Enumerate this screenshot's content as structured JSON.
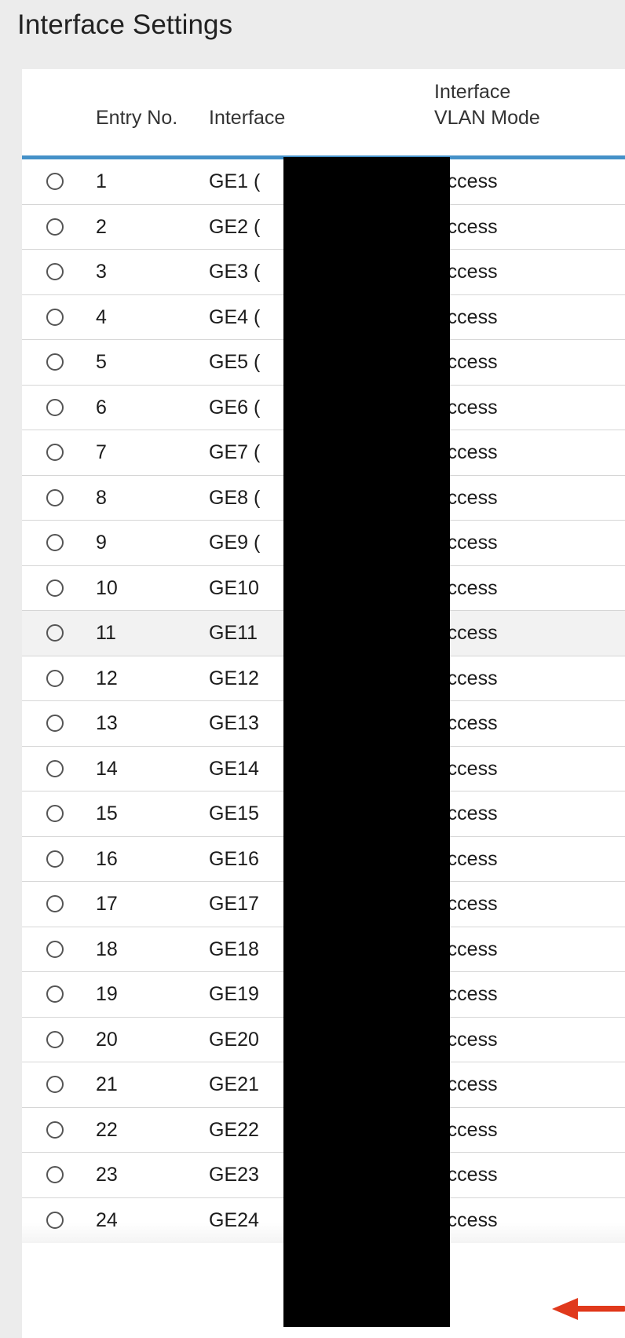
{
  "page": {
    "title": "Interface Settings",
    "background_color": "#ececec"
  },
  "table": {
    "accent_color": "#4591c8",
    "columns": [
      {
        "key": "select",
        "label": ""
      },
      {
        "key": "entry_no",
        "label": "Entry No."
      },
      {
        "key": "interface",
        "label": "Interface"
      },
      {
        "key": "vlan_mode",
        "label": "Interface\nVLAN Mode"
      }
    ],
    "rows": [
      {
        "entry_no": "1",
        "interface": "GE1 (",
        "vlan_mode": "Access",
        "highlighted": false
      },
      {
        "entry_no": "2",
        "interface": "GE2 (",
        "vlan_mode": "Access",
        "highlighted": false
      },
      {
        "entry_no": "3",
        "interface": "GE3 (",
        "vlan_mode": "Access",
        "highlighted": false
      },
      {
        "entry_no": "4",
        "interface": "GE4 (",
        "vlan_mode": "Access",
        "highlighted": false
      },
      {
        "entry_no": "5",
        "interface": "GE5 (",
        "vlan_mode": "Access",
        "highlighted": false
      },
      {
        "entry_no": "6",
        "interface": "GE6 (",
        "vlan_mode": "Access",
        "highlighted": false
      },
      {
        "entry_no": "7",
        "interface": "GE7 (",
        "vlan_mode": "Access",
        "highlighted": false
      },
      {
        "entry_no": "8",
        "interface": "GE8 (",
        "vlan_mode": "Access",
        "highlighted": false
      },
      {
        "entry_no": "9",
        "interface": "GE9 (",
        "vlan_mode": "Access",
        "highlighted": false
      },
      {
        "entry_no": "10",
        "interface": "GE10",
        "vlan_mode": "Access",
        "highlighted": false
      },
      {
        "entry_no": "11",
        "interface": "GE11",
        "vlan_mode": "Access",
        "highlighted": true
      },
      {
        "entry_no": "12",
        "interface": "GE12",
        "vlan_mode": "Access",
        "highlighted": false
      },
      {
        "entry_no": "13",
        "interface": "GE13",
        "vlan_mode": "Access",
        "highlighted": false
      },
      {
        "entry_no": "14",
        "interface": "GE14",
        "vlan_mode": "Access",
        "highlighted": false
      },
      {
        "entry_no": "15",
        "interface": "GE15",
        "vlan_mode": "Access",
        "highlighted": false
      },
      {
        "entry_no": "16",
        "interface": "GE16",
        "vlan_mode": "Access",
        "highlighted": false
      },
      {
        "entry_no": "17",
        "interface": "GE17",
        "vlan_mode": "Access",
        "highlighted": false
      },
      {
        "entry_no": "18",
        "interface": "GE18",
        "vlan_mode": "Access",
        "highlighted": false
      },
      {
        "entry_no": "19",
        "interface": "GE19",
        "vlan_mode": "Access",
        "highlighted": false
      },
      {
        "entry_no": "20",
        "interface": "GE20",
        "vlan_mode": "Access",
        "highlighted": false
      },
      {
        "entry_no": "21",
        "interface": "GE21",
        "vlan_mode": "Access",
        "highlighted": false
      },
      {
        "entry_no": "22",
        "interface": "GE22",
        "vlan_mode": "Access",
        "highlighted": false
      },
      {
        "entry_no": "23",
        "interface": "GE23",
        "vlan_mode": "Access",
        "highlighted": false
      },
      {
        "entry_no": "24",
        "interface": "GE24",
        "vlan_mode": "Access",
        "highlighted": false
      }
    ]
  },
  "overlays": {
    "redaction": {
      "name": "redaction-box",
      "color": "#000000"
    },
    "arrow": {
      "name": "annotation-arrow",
      "color": "#e0391c",
      "direction": "left",
      "points_at": "Access"
    }
  }
}
